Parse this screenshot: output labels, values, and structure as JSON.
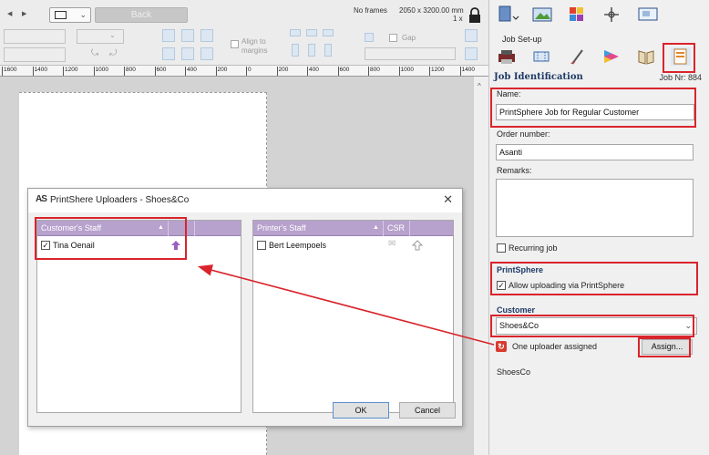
{
  "toolbar": {
    "back_label": "Back",
    "frames_label": "No frames",
    "frame_size": "2050 x 3200.00 mm",
    "frame_count": "1 x",
    "align_margins_label": "Align to margins",
    "gap_label": "Gap"
  },
  "ruler": {
    "ticks": [
      "1600",
      "1400",
      "1200",
      "1000",
      "800",
      "600",
      "400",
      "200",
      "0",
      "200",
      "400",
      "600",
      "800",
      "1000",
      "1200",
      "1400"
    ]
  },
  "dialog": {
    "title": "PrintShere Uploaders - Shoes&Co",
    "logo": "AS",
    "customer_staff": {
      "header": "Customer's Staff",
      "rows": [
        {
          "name": "Tina Oenail",
          "checked": true
        }
      ]
    },
    "printer_staff": {
      "header": "Printer's Staff",
      "csr_header": "CSR",
      "rows": [
        {
          "name": "Bert Leempoels",
          "checked": false
        }
      ]
    },
    "ok_label": "OK",
    "cancel_label": "Cancel"
  },
  "sidepanel": {
    "section_label": "Job Set-up",
    "job_identification_title": "Job Identification",
    "job_nr": "Job Nr: 884",
    "name_label": "Name:",
    "name_value": "PrintSphere Job for Regular Customer",
    "order_number_label": "Order number:",
    "order_number_value": "Asanti",
    "remarks_label": "Remarks:",
    "remarks_value": "",
    "recurring_job_label": "Recurring job",
    "recurring_job_checked": false,
    "printsphere_title": "PrintSphere",
    "allow_upload_label": "Allow uploading via PrintSphere",
    "allow_upload_checked": true,
    "customer_title": "Customer",
    "customer_value": "Shoes&Co",
    "uploader_status": "One uploader assigned",
    "assign_label": "Assign...",
    "customer_code": "ShoesCo"
  },
  "colors": {
    "highlight": "#d9242c",
    "list_header": "#b7a1cd",
    "section_title": "#1e3a66",
    "upload_arrow": "#9b5fc0"
  }
}
